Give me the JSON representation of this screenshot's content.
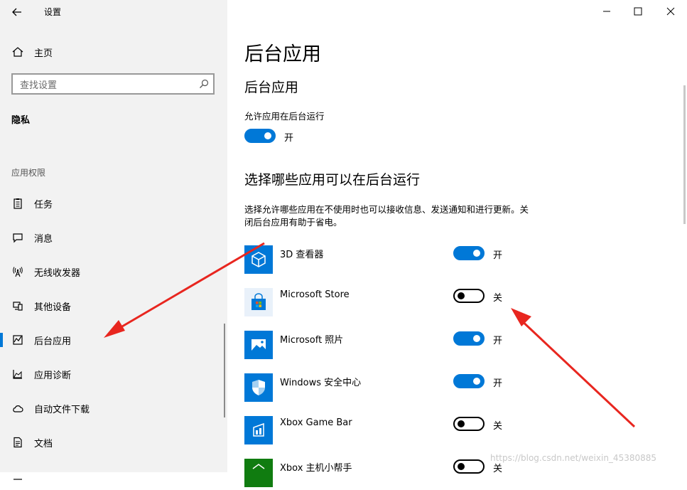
{
  "window": {
    "title": "设置",
    "back_icon": "back-arrow-icon",
    "controls": [
      "minimize-icon",
      "maximize-icon",
      "close-icon"
    ]
  },
  "sidebar": {
    "home_label": "主页",
    "search_placeholder": "查找设置",
    "privacy_label": "隐私",
    "permissions_header": "应用权限",
    "items": [
      {
        "label": "任务",
        "icon": "task-clipboard-icon"
      },
      {
        "label": "消息",
        "icon": "message-icon"
      },
      {
        "label": "无线收发器",
        "icon": "radio-tower-icon"
      },
      {
        "label": "其他设备",
        "icon": "devices-icon"
      },
      {
        "label": "后台应用",
        "icon": "background-apps-icon",
        "active": true
      },
      {
        "label": "应用诊断",
        "icon": "diagnostics-chart-icon"
      },
      {
        "label": "自动文件下载",
        "icon": "cloud-icon"
      },
      {
        "label": "文档",
        "icon": "document-icon"
      }
    ]
  },
  "main": {
    "page_title": "后台应用",
    "section1_title": "后台应用",
    "allow_label": "允许应用在后台运行",
    "allow_state": "开",
    "section2_title": "选择哪些应用可以在后台运行",
    "description_line1": "选择允许哪些应用在不使用时也可以接收信息、发送通知和进行更新。关",
    "description_line2": "闭后台应用有助于省电。",
    "apps": [
      {
        "name": "3D 查看器",
        "on": true,
        "state": "开",
        "icon": "3d-cube-icon"
      },
      {
        "name": "Microsoft Store",
        "on": false,
        "state": "关",
        "icon": "store-bag-icon"
      },
      {
        "name": "Microsoft 照片",
        "on": true,
        "state": "开",
        "icon": "photos-icon"
      },
      {
        "name": "Windows 安全中心",
        "on": true,
        "state": "开",
        "icon": "shield-icon"
      },
      {
        "name": "Xbox Game Bar",
        "on": false,
        "state": "关",
        "icon": "game-bar-icon"
      },
      {
        "name": "Xbox 主机小帮手",
        "on": false,
        "state": "关",
        "icon": "xbox-companion-icon"
      }
    ]
  },
  "watermark": "https://blog.csdn.net/weixin_45380885",
  "colors": {
    "accent": "#0078d7",
    "sidebar_bg": "#f2f2f2",
    "arrow": "#e8261f"
  }
}
